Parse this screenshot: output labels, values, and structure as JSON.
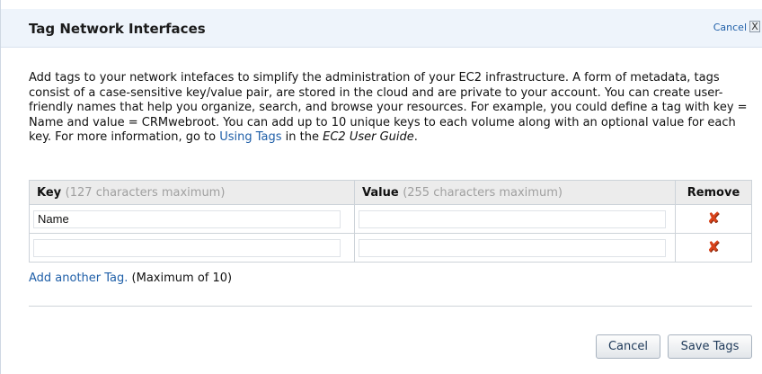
{
  "dialog": {
    "title": "Tag Network Interfaces",
    "cancel_link": "Cancel",
    "close_glyph": "X"
  },
  "intro": {
    "text_1": "Add tags to your network intefaces to simplify the administration of your EC2 infrastructure. A form of metadata, tags consist of a case-sensitive key/value pair, are stored in the cloud and are private to your account. You can create user-friendly names that help you organize, search, and browse your resources. For example, you could define a tag with key = Name and value = CRMwebroot. You can add up to 10 unique keys to each volume along with an optional value for each key. For more information, go to ",
    "link": "Using Tags",
    "text_2": " in the ",
    "guide": "EC2 User Guide",
    "text_3": "."
  },
  "table": {
    "key_header": "Key",
    "key_hint": "(127 characters maximum)",
    "value_header": "Value",
    "value_hint": "(255 characters maximum)",
    "remove_header": "Remove",
    "rows": [
      {
        "key": "Name",
        "value": ""
      },
      {
        "key": "",
        "value": ""
      }
    ],
    "remove_icon": "remove-x-icon"
  },
  "add": {
    "link": "Add another Tag.",
    "note": " (Maximum of 10)"
  },
  "buttons": {
    "cancel": "Cancel",
    "save": "Save Tags"
  },
  "colors": {
    "link": "#1f5fa8",
    "header_bg": "#eef4fb",
    "remove": "#d9431a"
  }
}
